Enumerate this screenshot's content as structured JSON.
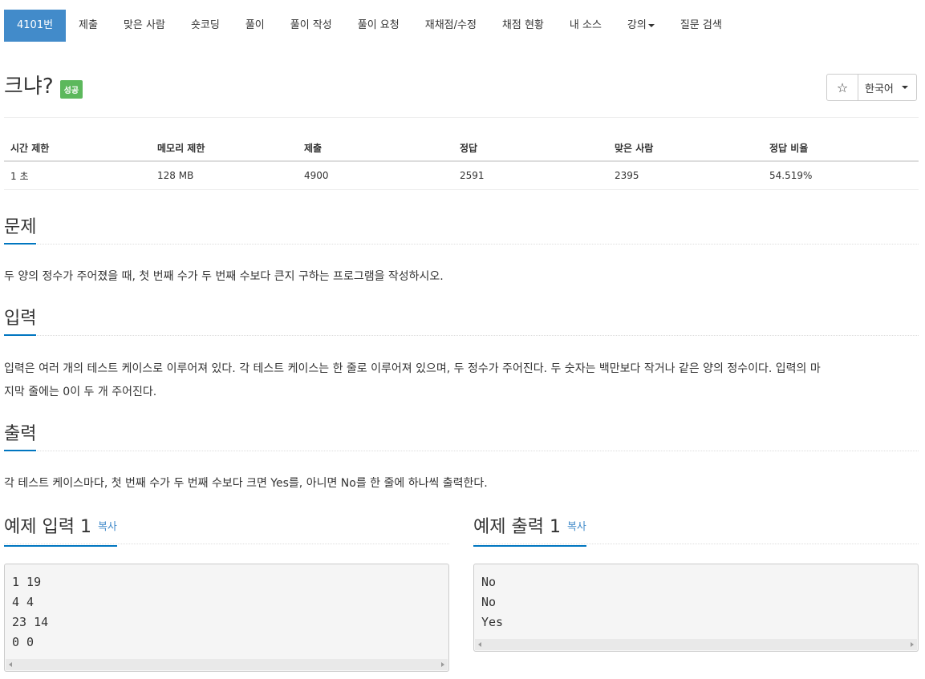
{
  "nav": {
    "items": [
      {
        "label": "4101번"
      },
      {
        "label": "제출"
      },
      {
        "label": "맞은 사람"
      },
      {
        "label": "숏코딩"
      },
      {
        "label": "풀이"
      },
      {
        "label": "풀이 작성"
      },
      {
        "label": "풀이 요청"
      },
      {
        "label": "재채점/수정"
      },
      {
        "label": "채점 현황"
      },
      {
        "label": "내 소스"
      },
      {
        "label": "강의"
      },
      {
        "label": "질문 검색"
      }
    ]
  },
  "problem": {
    "title": "크냐?",
    "badge": "성공",
    "star": "☆",
    "language": "한국어"
  },
  "stats": {
    "headers": [
      "시간 제한",
      "메모리 제한",
      "제출",
      "정답",
      "맞은 사람",
      "정답 비율"
    ],
    "values": [
      "1 초",
      "128 MB",
      "4900",
      "2591",
      "2395",
      "54.519%"
    ]
  },
  "sections": {
    "problem_heading": "문제",
    "problem_text": "두 양의 정수가 주어졌을 때, 첫 번째 수가 두 번째 수보다 큰지 구하는 프로그램을 작성하시오.",
    "input_heading": "입력",
    "input_text_line1": "입력은 여러 개의 테스트 케이스로 이루어져 있다. 각 테스트 케이스는 한 줄로 이루어져 있으며, 두 정수가 주어진다. 두 숫자는 백만보다 작거나 같은 양의 정수이다. 입력의 마",
    "input_text_line2": "지막 줄에는 0이 두 개 주어진다.",
    "output_heading": "출력",
    "output_text": "각 테스트 케이스마다, 첫 번째 수가 두 번째 수보다 크면 Yes를, 아니면 No를 한 줄에 하나씩 출력한다."
  },
  "examples": {
    "input_heading": "예제 입력 1",
    "output_heading": "예제 출력 1",
    "copy_label": "복사",
    "input_lines": [
      "1 19",
      "4 4",
      "23 14",
      "0 0"
    ],
    "output_lines": [
      "No",
      "No",
      "Yes"
    ]
  },
  "colors": {
    "active_tab": "#428bca",
    "badge": "#5cb85c",
    "heading_underline": "#0076c0"
  }
}
